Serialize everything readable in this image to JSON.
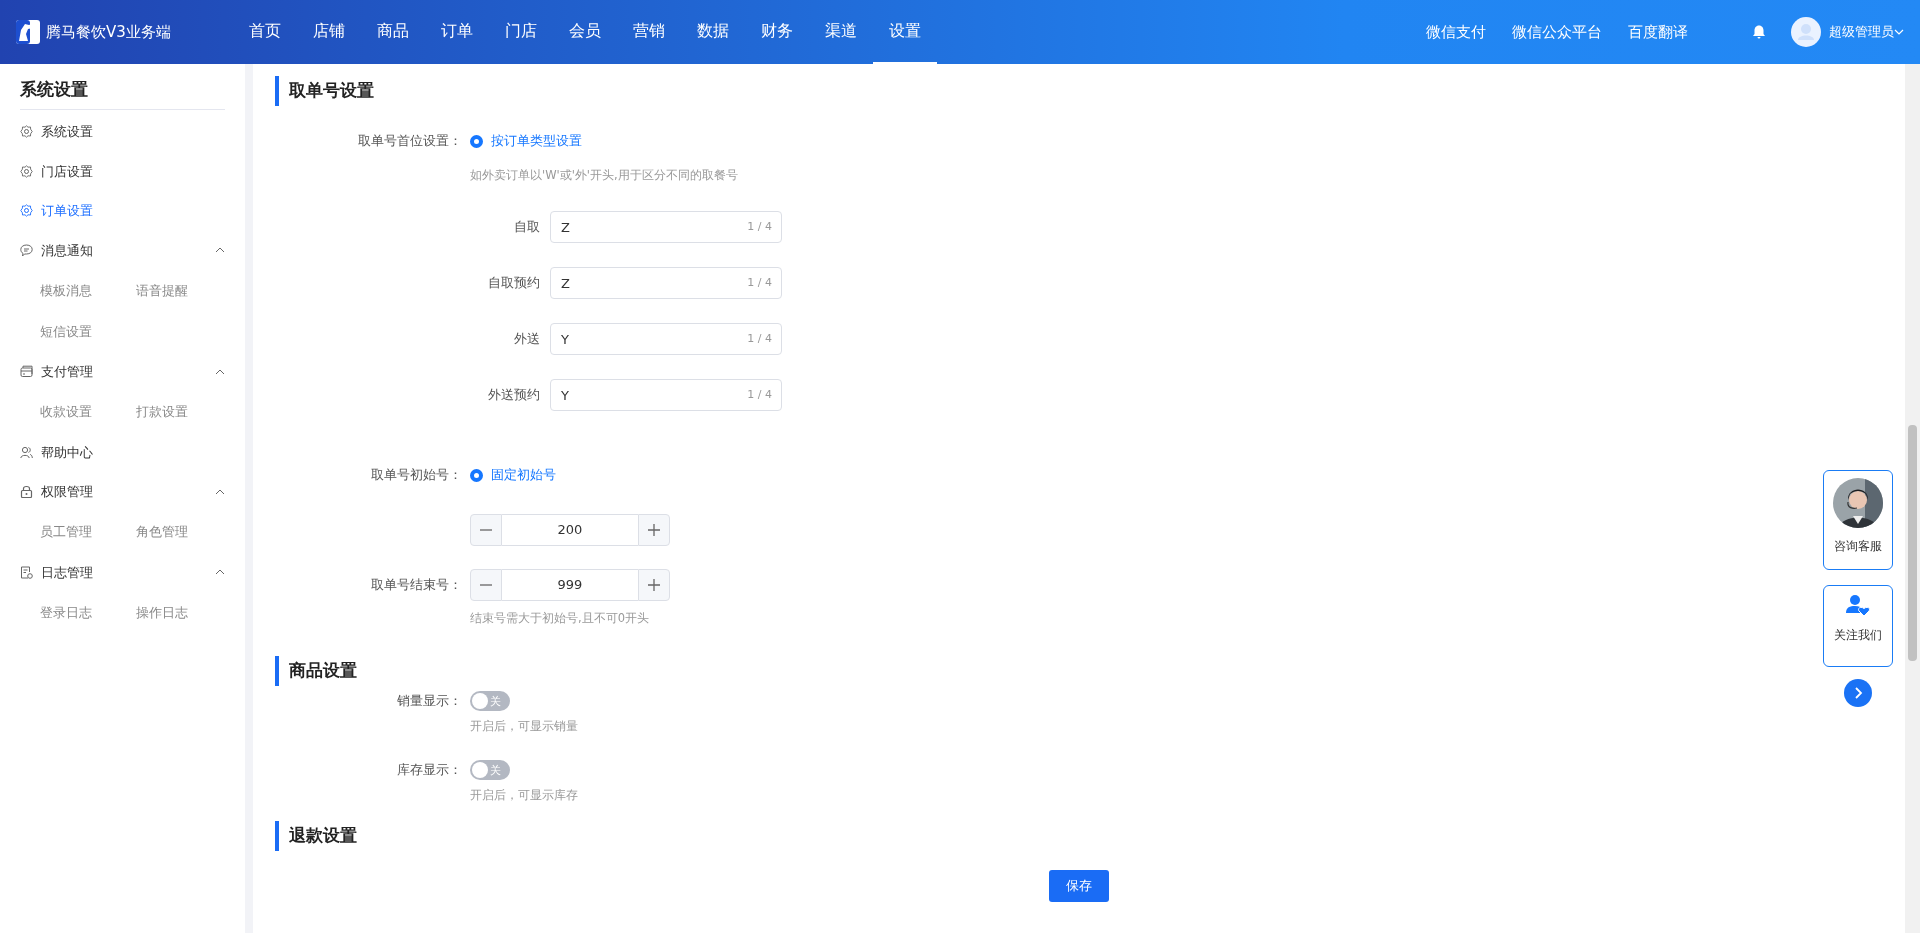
{
  "header": {
    "logo_text": "腾马餐饮V3业务端",
    "nav": [
      {
        "label": "首页",
        "selected": false
      },
      {
        "label": "店铺",
        "selected": false
      },
      {
        "label": "商品",
        "selected": false
      },
      {
        "label": "订单",
        "selected": false
      },
      {
        "label": "门店",
        "selected": false
      },
      {
        "label": "会员",
        "selected": false
      },
      {
        "label": "营销",
        "selected": false
      },
      {
        "label": "数据",
        "selected": false
      },
      {
        "label": "财务",
        "selected": false
      },
      {
        "label": "渠道",
        "selected": false
      },
      {
        "label": "设置",
        "selected": true
      }
    ],
    "links": [
      "微信支付",
      "微信公众平台",
      "百度翻译"
    ],
    "user": "超级管理员"
  },
  "sidebar": {
    "title": "系统设置",
    "items": [
      {
        "label": "系统设置",
        "selected": false
      },
      {
        "label": "门店设置",
        "selected": false
      },
      {
        "label": "订单设置",
        "selected": true
      },
      {
        "label": "消息通知",
        "selected": false,
        "expanded": true,
        "children": [
          {
            "label": "模板消息",
            "selected": false
          },
          {
            "label": "语音提醒",
            "selected": false
          },
          {
            "label": "短信设置",
            "selected": false
          }
        ]
      },
      {
        "label": "支付管理",
        "selected": false,
        "expanded": true,
        "children": [
          {
            "label": "收款设置",
            "selected": false
          },
          {
            "label": "打款设置",
            "selected": false
          }
        ]
      },
      {
        "label": "帮助中心",
        "selected": false
      },
      {
        "label": "权限管理",
        "selected": false,
        "expanded": true,
        "children": [
          {
            "label": "员工管理",
            "selected": false
          },
          {
            "label": "角色管理",
            "selected": false
          }
        ]
      },
      {
        "label": "日志管理",
        "selected": false,
        "expanded": true,
        "children": [
          {
            "label": "登录日志",
            "selected": false
          },
          {
            "label": "操作日志",
            "selected": false
          }
        ]
      }
    ]
  },
  "sections": [
    {
      "title": "取单号设置",
      "fields": [
        {
          "kind": "radio",
          "label": "取单号首位设置：",
          "option": "按订单类型设置",
          "selected": true,
          "hint": "如外卖订单以'W'或'外'开头,用于区分不同的取餐号"
        },
        {
          "kind": "input",
          "label": "自取",
          "value": "Z",
          "counter": "1 / 4"
        },
        {
          "kind": "input",
          "label": "自取预约",
          "value": "Z",
          "counter": "1 / 4"
        },
        {
          "kind": "input",
          "label": "外送",
          "value": "Y",
          "counter": "1 / 4"
        },
        {
          "kind": "input",
          "label": "外送预约",
          "value": "Y",
          "counter": "1 / 4"
        },
        {
          "kind": "radio",
          "label": "取单号初始号：",
          "option": "固定初始号",
          "selected": true
        },
        {
          "kind": "stepper",
          "value": "200"
        },
        {
          "kind": "stepper",
          "label": "取单号结束号：",
          "value": "999",
          "hint": "结束号需大于初始号,且不可0开头"
        }
      ]
    },
    {
      "title": "商品设置",
      "fields": [
        {
          "kind": "switch",
          "label": "销量显示：",
          "on": false,
          "switch_text": "关",
          "hint": "开启后，可显示销量"
        },
        {
          "kind": "switch",
          "label": "库存显示：",
          "on": false,
          "switch_text": "关",
          "hint": "开启后，可显示库存"
        }
      ]
    },
    {
      "title": "退款设置"
    }
  ],
  "save_button": "保存",
  "float_buttons": [
    {
      "kind": "avatar",
      "label": "咨询客服"
    },
    {
      "kind": "follow",
      "label": "关注我们"
    }
  ]
}
